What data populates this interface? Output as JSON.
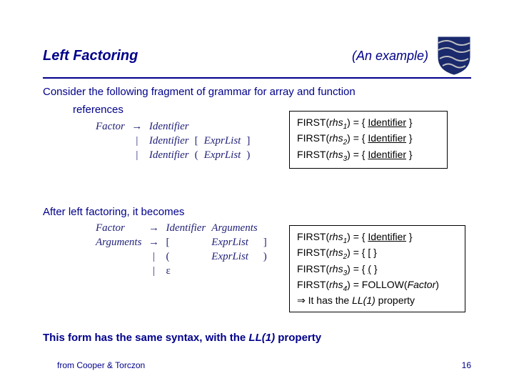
{
  "header": {
    "title": "Left Factoring",
    "example": "(An  example)"
  },
  "intro_line1": "Consider the following fragment of grammar for array and function",
  "intro_line2": "references",
  "grammar1": {
    "lhs": "Factor",
    "r1_a": "Identifier",
    "r2_a": "Identifier",
    "r2_b": "[",
    "r2_c": "ExprList",
    "r2_d": "]",
    "r3_a": "Identifier",
    "r3_b": "(",
    "r3_c": "ExprList",
    "r3_d": ")"
  },
  "box1": {
    "l1_a": "F",
    "l1_b": "IRST",
    "l1_c": "(",
    "l1_d": "rhs",
    "l1_e": "1",
    "l1_f": ") = { ",
    "l1_g": "Identifier",
    "l1_h": " }",
    "l2_a": "F",
    "l2_b": "IRST",
    "l2_c": "(",
    "l2_d": "rhs",
    "l2_e": "2",
    "l2_f": ") = { ",
    "l2_g": "Identifier",
    "l2_h": " }",
    "l3_a": "F",
    "l3_b": "IRST",
    "l3_c": "(",
    "l3_d": "rhs",
    "l3_e": "3",
    "l3_f": ") = { ",
    "l3_g": "Identifier",
    "l3_h": " }"
  },
  "after": "After left factoring, it becomes",
  "grammar2": {
    "lhs1": "Factor",
    "r1_a": "Identifier",
    "r1_b": "Arguments",
    "lhs2": "Arguments",
    "r2_a": "[",
    "r2_b": "ExprList",
    "r2_c": "]",
    "r3_a": "(",
    "r3_b": "ExprList",
    "r3_c": ")",
    "r4_a": "ε"
  },
  "box2": {
    "l1_a": "F",
    "l1_b": "IRST",
    "l1_c": "(",
    "l1_d": "rhs",
    "l1_e": "1",
    "l1_f": ") = { ",
    "l1_g": "Identifier",
    "l1_h": " }",
    "l2_a": "F",
    "l2_b": "IRST",
    "l2_c": "(",
    "l2_d": "rhs",
    "l2_e": "2",
    "l2_f": ") = { ",
    "l2_g": "[",
    "l2_h": " }",
    "l3_a": "F",
    "l3_b": "IRST",
    "l3_c": "(",
    "l3_d": "rhs",
    "l3_e": "3",
    "l3_f": ") = { ",
    "l3_g": "(",
    "l3_h": " }",
    "l4_a": "F",
    "l4_b": "IRST",
    "l4_c": "(",
    "l4_d": "rhs",
    "l4_e": "4",
    "l4_f": ") = F",
    "l4_g": "OLLOW",
    "l4_h": "(",
    "l4_i": "Factor",
    "l4_j": ")",
    "l5_a": "⇒",
    "l5_b": " It has the ",
    "l5_c": "LL(1)",
    "l5_d": " property"
  },
  "conclusion_a": "This form has the same syntax, with the ",
  "conclusion_b": "LL(1)",
  "conclusion_c": " property",
  "footer": {
    "left": "from Cooper & Torczon",
    "right": "16"
  }
}
